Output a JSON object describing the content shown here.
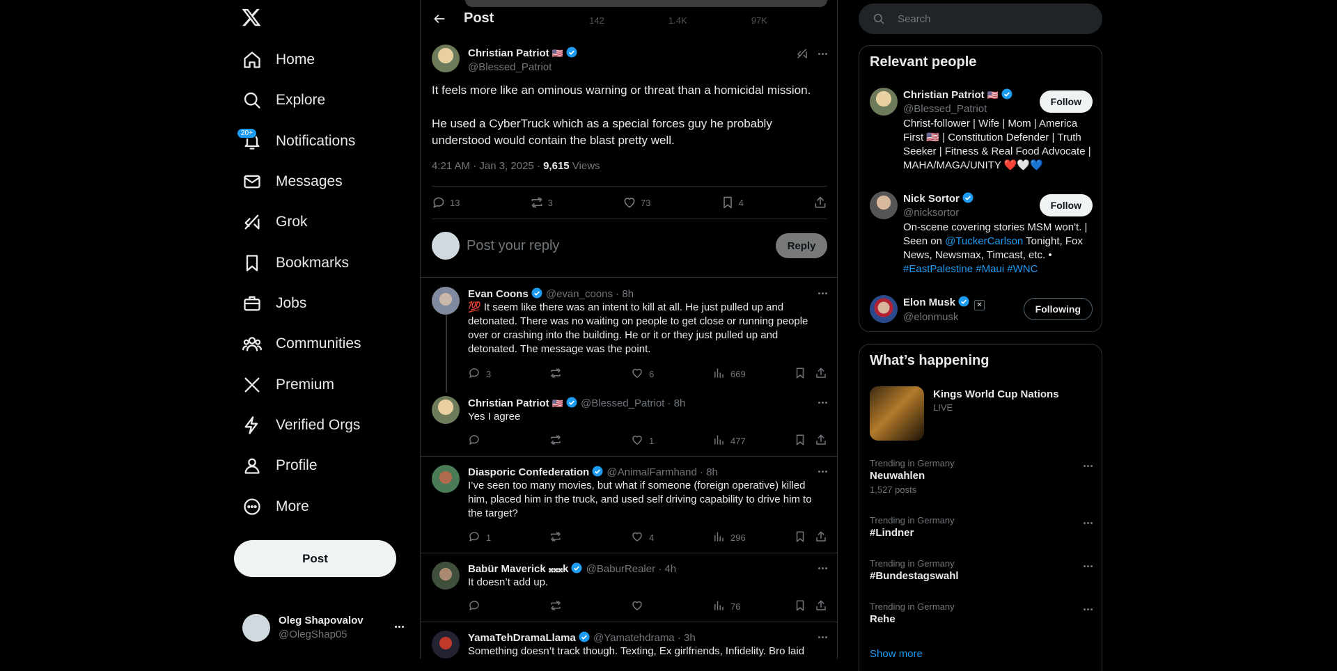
{
  "nav": {
    "items": [
      {
        "label": "Home",
        "icon": "home-icon"
      },
      {
        "label": "Explore",
        "icon": "search-icon"
      },
      {
        "label": "Notifications",
        "icon": "bell-icon",
        "badge": "20+"
      },
      {
        "label": "Messages",
        "icon": "mail-icon"
      },
      {
        "label": "Grok",
        "icon": "grok-icon"
      },
      {
        "label": "Bookmarks",
        "icon": "bookmark-icon"
      },
      {
        "label": "Jobs",
        "icon": "briefcase-icon"
      },
      {
        "label": "Communities",
        "icon": "people-icon"
      },
      {
        "label": "Premium",
        "icon": "x-logo-icon"
      },
      {
        "label": "Verified Orgs",
        "icon": "lightning-icon"
      },
      {
        "label": "Profile",
        "icon": "person-icon"
      },
      {
        "label": "More",
        "icon": "more-circle-icon"
      }
    ],
    "post_label": "Post",
    "account": {
      "name": "Oleg Shapovalov",
      "handle": "@OlegShap05"
    }
  },
  "header": {
    "title": "Post"
  },
  "ghost_bar": {
    "retweets": "142",
    "likes": "1.4K",
    "views": "97K"
  },
  "main_post": {
    "name": "Christian Patriot",
    "flag": "🇺🇸",
    "handle": "@Blessed_Patriot",
    "paragraphs": [
      "It feels more like an ominous warning or threat than a homicidal mission.",
      "He used a CyberTruck which as a special forces guy he probably understood would contain the blast pretty well."
    ],
    "time": "4:21 AM · Jan 3, 2025 · ",
    "views_count": "9,615",
    "views_label": " Views",
    "stats": {
      "replies": "13",
      "reposts": "3",
      "likes": "73",
      "bookmarks": "4"
    }
  },
  "reply_box": {
    "placeholder": "Post your reply",
    "button": "Reply"
  },
  "replies": [
    {
      "name": "Evan Coons",
      "handle": "@evan_coons",
      "time": "· 8h",
      "text": "💯 It seem like there was an intent to kill at all. He just pulled up and detonated. There was no waiting on people to get close or running people over or crashing into the building. He or it or they just pulled up and detonated. The message was the point.",
      "replies": "3",
      "reposts": "",
      "likes": "6",
      "views": "669"
    },
    {
      "name": "Christian Patriot",
      "flag": "🇺🇸",
      "handle": "@Blessed_Patriot",
      "time": "· 8h",
      "text": "Yes I agree",
      "replies": "",
      "reposts": "",
      "likes": "1",
      "views": "477"
    },
    {
      "name": "Diasporic Confederation",
      "handle": "@AnimalFarmhand",
      "time": "· 8h",
      "text": "I’ve seen too many movies, but what if someone (foreign operative) killed him, placed him in the truck, and used self driving capability to drive him to the target?",
      "replies": "1",
      "reposts": "",
      "likes": "4",
      "views": "296"
    },
    {
      "name": "Babür Maverick 𝄪𝄪𝄪k",
      "handle": "@BaburRealer",
      "time": "· 4h",
      "text": "It doesn’t add up.",
      "replies": "",
      "reposts": "",
      "likes": "",
      "views": "76"
    },
    {
      "name": "YamaTehDramaLlama",
      "handle": "@Yamatehdrama",
      "time": "· 3h",
      "text": "Something doesn’t track though. Texting, Ex girlfriends, Infidelity. Bro laid"
    }
  ],
  "search": {
    "placeholder": "Search"
  },
  "relevant": {
    "title": "Relevant people",
    "people": [
      {
        "name": "Christian Patriot",
        "flag": "🇺🇸",
        "handle": "@Blessed_Patriot",
        "button": "Follow",
        "bio": "Christ-follower | Wife | Mom | America First 🇺🇸 | Constitution Defender | Truth Seeker | Fitness & Real Food Advocate | MAHA/MAGA/UNITY ❤️🤍💙"
      },
      {
        "name": "Nick Sortor",
        "handle": "@nicksortor",
        "button": "Follow",
        "bio_pre": "On-scene covering stories MSM won't. | Seen on ",
        "bio_link1": "@TuckerCarlson",
        "bio_mid": " Tonight, Fox News, Newsmax, Timcast, etc. • ",
        "bio_tags": "#EastPalestine #Maui #WNC"
      },
      {
        "name": "Elon Musk",
        "handle": "@elonmusk",
        "button": "Following"
      }
    ]
  },
  "happening": {
    "title": "What’s happening",
    "event": {
      "title": "Kings World Cup Nations",
      "status": "LIVE"
    },
    "trends": [
      {
        "context": "Trending in Germany",
        "topic": "Neuwahlen",
        "count": "1,527 posts"
      },
      {
        "context": "Trending in Germany",
        "topic": "#Lindner",
        "count": ""
      },
      {
        "context": "Trending in Germany",
        "topic": "#Bundestagswahl",
        "count": ""
      },
      {
        "context": "Trending in Germany",
        "topic": "Rehe",
        "count": ""
      }
    ],
    "show_more": "Show more"
  },
  "colors": {
    "accent": "#1d9bf0",
    "background": "#000000",
    "border": "#2f3336",
    "muted": "#71767b"
  }
}
